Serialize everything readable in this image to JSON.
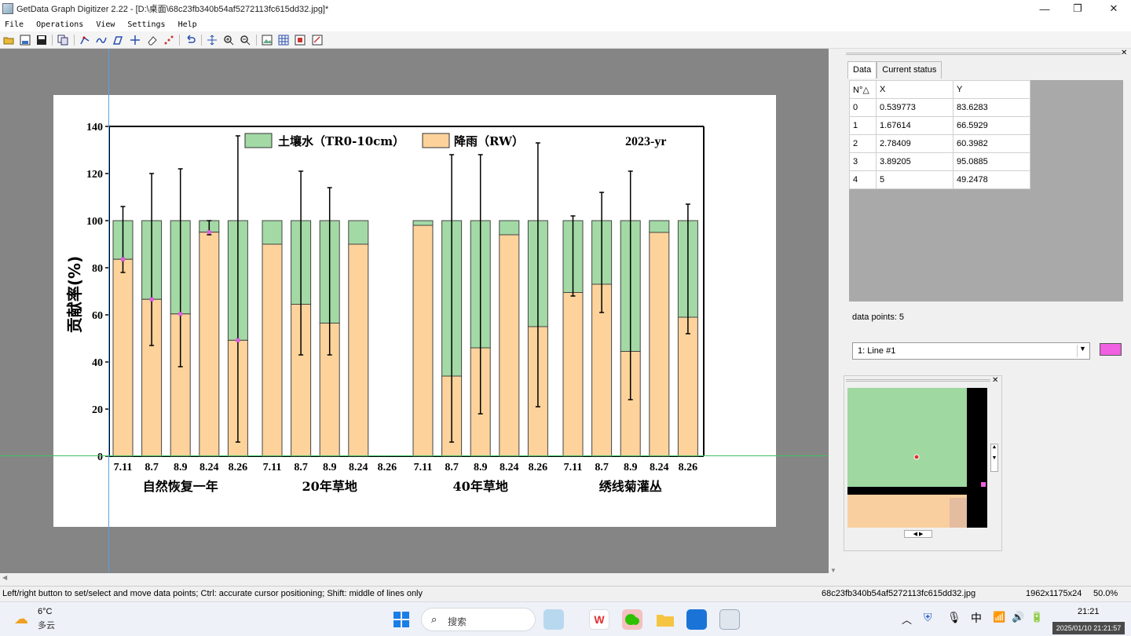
{
  "window": {
    "title": "GetData Graph Digitizer 2.22 - [D:\\桌面\\68c23fb340b54af5272113fc615dd32.jpg]*",
    "minimize": "—",
    "maximize": "❐",
    "close": "✕"
  },
  "menu": [
    "File",
    "Operations",
    "View",
    "Settings",
    "Help"
  ],
  "toolbar": {
    "icons": [
      "open-icon",
      "save-as-icon",
      "save-icon",
      "copy-icon",
      "point-capture-icon",
      "line-capture-icon",
      "area-capture-icon",
      "move-icon",
      "eraser-icon",
      "segment-icon",
      "undo-icon",
      "pan-icon",
      "zoom-in-icon",
      "zoom-out-icon",
      "image-icon",
      "grid-icon",
      "scale-icon",
      "fit-icon"
    ]
  },
  "plot": {
    "y_ticks": [
      "140",
      "120",
      "100",
      "80",
      "60",
      "40",
      "20",
      "0"
    ],
    "ylabel": "贡献率(%)",
    "legend": [
      {
        "label": "土壤水（TR0-10cm）",
        "color": "#a3d9a5"
      },
      {
        "label": "降雨（RW）",
        "color": "#fdd39b"
      }
    ],
    "year": "2023-yr",
    "groups": [
      {
        "name": "自然恢复一年",
        "dates": [
          "7.11",
          "8.7",
          "8.9",
          "8.24",
          "8.26"
        ],
        "rain": [
          83.6,
          66.6,
          60.4,
          95.1,
          49.2
        ],
        "err_top": [
          106,
          120,
          122,
          100,
          136
        ],
        "err_bot": [
          78,
          47,
          38,
          94,
          6
        ],
        "err_rain": [
          [
            78,
            90
          ],
          [
            47,
            86
          ],
          [
            38,
            82
          ],
          [
            94,
            96
          ],
          [
            6,
            92
          ]
        ]
      },
      {
        "name": "20年草地",
        "dates": [
          "7.11",
          "8.7",
          "8.9",
          "8.24",
          "8.26"
        ],
        "rain": [
          90,
          64.5,
          56.5,
          90,
          0
        ],
        "err_top": [
          null,
          121,
          114,
          null,
          null
        ],
        "err_bot": [
          null,
          43,
          43,
          null,
          null
        ],
        "err_rain": [
          null,
          [
            43,
            86
          ],
          [
            43,
            70
          ],
          null,
          null
        ]
      },
      {
        "name": "40年草地",
        "dates": [
          "7.11",
          "8.7",
          "8.9",
          "8.24",
          "8.26"
        ],
        "rain": [
          98,
          34,
          46,
          94,
          55
        ],
        "err_top": [
          null,
          128,
          128,
          null,
          133
        ],
        "err_bot": [
          null,
          6,
          18,
          null,
          21
        ],
        "err_rain": [
          null,
          [
            6,
            62
          ],
          [
            18,
            74
          ],
          null,
          [
            21,
            88
          ]
        ]
      },
      {
        "name": "绣线菊灌丛",
        "dates": [
          "7.11",
          "8.7",
          "8.9",
          "8.24",
          "8.26"
        ],
        "rain": [
          69.5,
          73,
          44.5,
          95,
          59
        ],
        "err_top": [
          102,
          112,
          121,
          null,
          107
        ],
        "err_bot": [
          68,
          61,
          24,
          null,
          52
        ],
        "err_rain": [
          [
            68,
            72
          ],
          [
            61,
            85
          ],
          [
            24,
            65
          ],
          null,
          [
            52,
            66
          ]
        ]
      }
    ],
    "colors": {
      "soil": "#a3d9a5",
      "rain": "#fdd39b",
      "marker": "#e060e0"
    }
  },
  "panel": {
    "tabs": [
      "Data",
      "Current status"
    ],
    "columns": [
      "N°△",
      "X",
      "Y"
    ],
    "rows": [
      [
        "0",
        "0.539773",
        "83.6283"
      ],
      [
        "1",
        "1.67614",
        "66.5929"
      ],
      [
        "2",
        "2.78409",
        "60.3982"
      ],
      [
        "3",
        "3.89205",
        "95.0885"
      ],
      [
        "4",
        "5",
        "49.2478"
      ]
    ],
    "data_points": "data points: 5",
    "line_select": "1: Line #1",
    "line_color": "#f060e0"
  },
  "status": {
    "hint": "Left/right button to set/select and move data points; Ctrl: accurate cursor positioning; Shift: middle of lines only",
    "file": "68c23fb340b54af5272113fc615dd32.jpg",
    "size": "1962x1175x24",
    "zoom": "50.0%"
  },
  "taskbar": {
    "temp": "6°C",
    "weather": "多云",
    "search": "搜索",
    "time": "21:21",
    "ime": "中",
    "stamp": "2025/01/10 21:21:57"
  }
}
